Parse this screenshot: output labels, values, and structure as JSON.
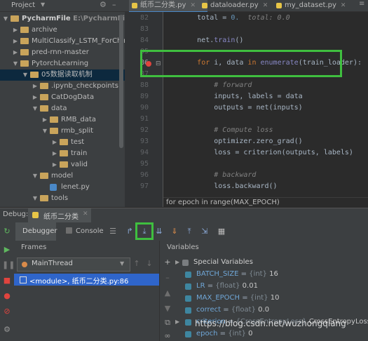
{
  "tabs": [
    {
      "label": "纸币二分类.py",
      "active": true
    },
    {
      "label": "dataloader.py",
      "active": false
    },
    {
      "label": "my_dataset.py",
      "active": false
    }
  ],
  "project": {
    "label": "Project",
    "tree": [
      {
        "label": "PycharmFile",
        "extra": "E:\\PycharmFile",
        "kind": "folder",
        "depth": 0,
        "open": true
      },
      {
        "label": "archive",
        "kind": "folder",
        "depth": 1,
        "open": false
      },
      {
        "label": "MultiClassify_LSTM_ForChinese",
        "kind": "folder",
        "depth": 1,
        "open": false
      },
      {
        "label": "pred-rnn-master",
        "kind": "folder",
        "depth": 1,
        "open": false
      },
      {
        "label": "PytorchLearning",
        "kind": "folder",
        "depth": 1,
        "open": true
      },
      {
        "label": "05数据读取机制",
        "kind": "folder",
        "depth": 2,
        "open": true,
        "selected": true
      },
      {
        "label": ".ipynb_checkpoints",
        "kind": "folder",
        "depth": 3,
        "open": false
      },
      {
        "label": "CatDogData",
        "kind": "folder",
        "depth": 3,
        "open": false
      },
      {
        "label": "data",
        "kind": "folder",
        "depth": 3,
        "open": true
      },
      {
        "label": "RMB_data",
        "kind": "folder",
        "depth": 4,
        "open": false
      },
      {
        "label": "rmb_split",
        "kind": "folder",
        "depth": 4,
        "open": true
      },
      {
        "label": "test",
        "kind": "folder",
        "depth": 5,
        "open": false
      },
      {
        "label": "train",
        "kind": "folder",
        "depth": 5,
        "open": false
      },
      {
        "label": "valid",
        "kind": "folder",
        "depth": 5,
        "open": false
      },
      {
        "label": "model",
        "kind": "folder",
        "depth": 3,
        "open": true
      },
      {
        "label": "lenet.py",
        "kind": "py",
        "depth": 4
      },
      {
        "label": "tools",
        "kind": "folder",
        "depth": 3,
        "open": true
      }
    ]
  },
  "editor": {
    "line_numbers": [
      "82",
      "83",
      "84",
      "85",
      "86",
      "87",
      "88",
      "89",
      "90",
      "91",
      "92",
      "93",
      "94",
      "95",
      "96",
      "97"
    ],
    "lines": [
      [
        {
          "t": "        total = ",
          "c": ""
        },
        {
          "t": "0.",
          "c": "num"
        },
        {
          "t": "  total: 0.0",
          "c": "cm"
        }
      ],
      [
        {
          "t": "",
          "c": ""
        }
      ],
      [
        {
          "t": "        net.",
          "c": ""
        },
        {
          "t": "train",
          "c": "bi"
        },
        {
          "t": "()",
          "c": ""
        }
      ],
      [
        {
          "t": "",
          "c": ""
        }
      ],
      [
        {
          "t": "        ",
          "c": ""
        },
        {
          "t": "for",
          "c": "kw"
        },
        {
          "t": " i, data ",
          "c": ""
        },
        {
          "t": "in",
          "c": "kw"
        },
        {
          "t": " ",
          "c": ""
        },
        {
          "t": "enumerate",
          "c": "bi"
        },
        {
          "t": "(train_loader):",
          "c": ""
        }
      ],
      [
        {
          "t": "",
          "c": ""
        }
      ],
      [
        {
          "t": "            # forward",
          "c": "cm"
        }
      ],
      [
        {
          "t": "            inputs, labels = data",
          "c": ""
        }
      ],
      [
        {
          "t": "            outputs = net(inputs)",
          "c": ""
        }
      ],
      [
        {
          "t": "",
          "c": ""
        }
      ],
      [
        {
          "t": "            # Compute loss",
          "c": "cm"
        }
      ],
      [
        {
          "t": "            optimizer.zero_grad()",
          "c": ""
        }
      ],
      [
        {
          "t": "            loss = criterion(outputs, labels)",
          "c": ""
        }
      ],
      [
        {
          "t": "",
          "c": ""
        }
      ],
      [
        {
          "t": "            # backward",
          "c": "cm"
        }
      ],
      [
        {
          "t": "            loss.backward()",
          "c": ""
        }
      ]
    ],
    "breadcrumb": "for epoch in range(MAX_EPOCH)"
  },
  "debug": {
    "label": "Debug:",
    "session": "纸币二分类",
    "tabs": [
      "Debugger",
      "Console"
    ],
    "frames_label": "Frames",
    "variables_label": "Variables",
    "thread": "MainThread",
    "frame": "<module>, 纸币二分类.py:86",
    "variables": [
      {
        "name": "Special Variables",
        "type": "",
        "value": "",
        "special": true
      },
      {
        "name": "BATCH_SIZE",
        "type": "{int}",
        "value": "16"
      },
      {
        "name": "LR",
        "type": "{float}",
        "value": "0.01"
      },
      {
        "name": "MAX_EPOCH",
        "type": "{int}",
        "value": "10"
      },
      {
        "name": "correct",
        "type": "{float}",
        "value": "0.0"
      },
      {
        "name": "criterion",
        "type": "{CrossEntropyLoss}",
        "value": "CrossEntropyLoss()"
      },
      {
        "name": "epoch",
        "type": "{int}",
        "value": "0"
      }
    ]
  },
  "watermark": "https://blog.csdn.net/wuzhongqiang",
  "colors": {
    "highlight_box": "#3fbf3f",
    "current_line": "#2d6099",
    "breakpoint": "#e0443e"
  }
}
